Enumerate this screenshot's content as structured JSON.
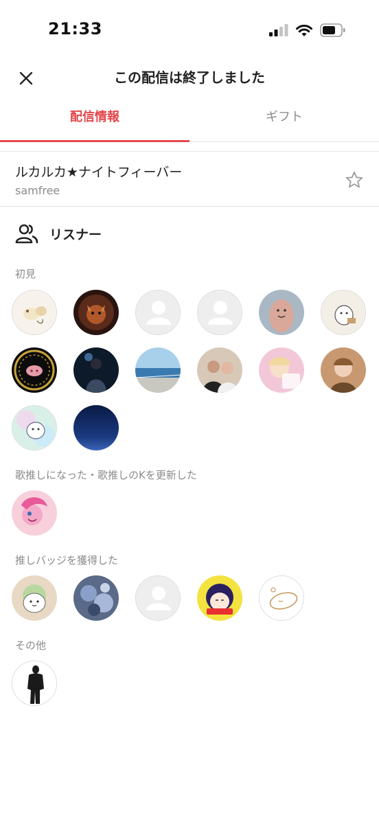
{
  "status_bar": {
    "time": "21:33"
  },
  "header": {
    "title": "この配信は終了しました"
  },
  "tabs": [
    {
      "label": "配信情報",
      "active": true
    },
    {
      "label": "ギフト",
      "active": false
    }
  ],
  "stream": {
    "title": "ルカルカ★ナイトフィーバー",
    "user": "samfree"
  },
  "listeners": {
    "title": "リスナー",
    "sections": [
      {
        "label": "初見",
        "count": 14
      },
      {
        "label": "歌推しになった・歌推しのKを更新した",
        "count": 1
      },
      {
        "label": "推しバッジを獲得した",
        "count": 5
      },
      {
        "label": "その他",
        "count": 1
      }
    ]
  },
  "colors": {
    "accent": "#e5464b",
    "muted": "#8a8a8a",
    "divider": "#e2e2e2"
  }
}
